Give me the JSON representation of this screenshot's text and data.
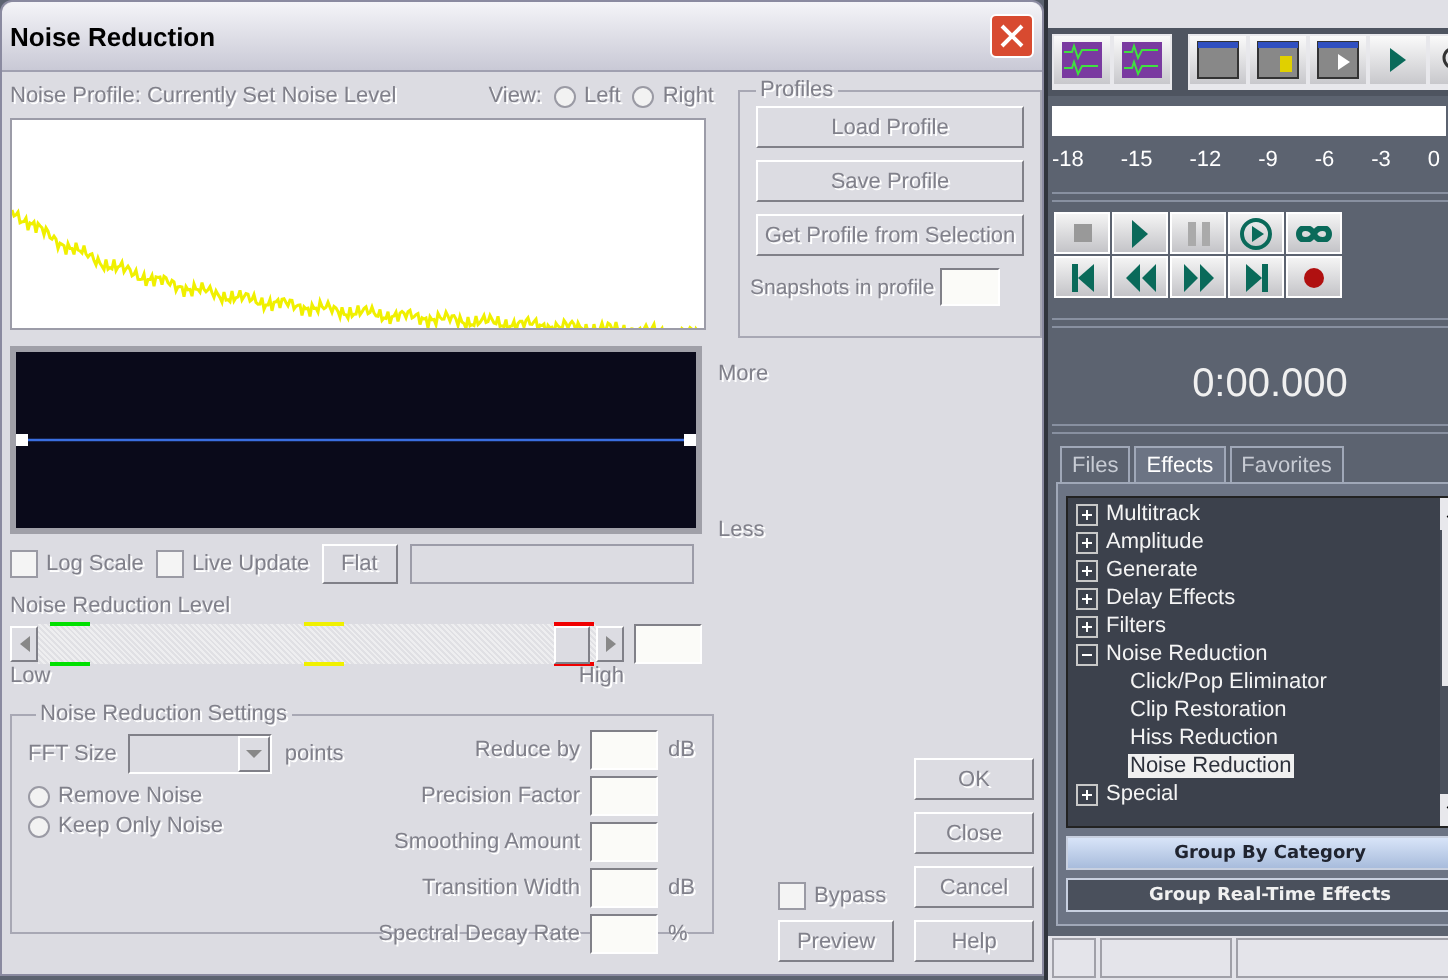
{
  "dialog": {
    "title": "Noise Reduction",
    "disabled": true,
    "profile_label": "Noise Profile: Currently Set Noise Level",
    "view": {
      "label": "View:",
      "options": [
        {
          "label": "Left",
          "selected": false
        },
        {
          "label": "Right",
          "selected": false
        }
      ]
    },
    "graph_labels": {
      "top": "More",
      "bottom": "Less"
    },
    "checkboxes": [
      {
        "label": "Log Scale",
        "checked": false
      },
      {
        "label": "Live Update",
        "checked": false
      }
    ],
    "flat_button": "Flat",
    "reduction_level": {
      "label": "Noise Reduction Level",
      "level": 0.99,
      "low": "Low",
      "high": "High"
    },
    "settings": {
      "title": "Noise Reduction Settings",
      "fft_label": "FFT Size",
      "fft_unit": "points",
      "modes": [
        {
          "label": "Remove Noise",
          "selected": false
        },
        {
          "label": "Keep Only Noise",
          "selected": false
        }
      ],
      "fields": [
        {
          "label": "Reduce by",
          "unit": "dB"
        },
        {
          "label": "Precision Factor"
        },
        {
          "label": "Smoothing Amount"
        },
        {
          "label": "Transition Width",
          "unit": "dB"
        },
        {
          "label": "Spectral Decay Rate",
          "unit": "%"
        }
      ]
    },
    "profiles": {
      "title": "Profiles",
      "buttons": [
        "Load Profile",
        "Save Profile",
        "Get Profile from Selection"
      ],
      "snapshots_label": "Snapshots in profile"
    },
    "bypass": {
      "label": "Bypass",
      "checked": false
    },
    "preview_button": "Preview",
    "buttons": [
      "OK",
      "Close",
      "Cancel",
      "Help"
    ]
  },
  "app": {
    "meter_ticks": [
      "-18",
      "-15",
      "-12",
      "-9",
      "-6",
      "-3",
      "0"
    ],
    "time": "0:00.000",
    "tabs": [
      {
        "label": "Files",
        "selected": false
      },
      {
        "label": "Effects",
        "selected": true
      },
      {
        "label": "Favorites",
        "selected": false
      }
    ],
    "tree": [
      {
        "label": "Multitrack",
        "expanded": false,
        "selected": false
      },
      {
        "label": "Amplitude",
        "expanded": false,
        "selected": false
      },
      {
        "label": "Generate",
        "expanded": false,
        "selected": false
      },
      {
        "label": "Delay Effects",
        "expanded": false,
        "selected": false
      },
      {
        "label": "Filters",
        "expanded": false,
        "selected": false
      },
      {
        "label": "Noise Reduction",
        "expanded": true,
        "selected": false,
        "children": [
          {
            "label": "Click/Pop Eliminator",
            "selected": false
          },
          {
            "label": "Clip Restoration",
            "selected": false
          },
          {
            "label": "Hiss Reduction",
            "selected": false
          },
          {
            "label": "Noise Reduction",
            "selected": true
          }
        ]
      },
      {
        "label": "Special",
        "expanded": false,
        "selected": false
      }
    ],
    "group_buttons": [
      {
        "label": "Group By Category",
        "selected": true
      },
      {
        "label": "Group Real-Time Effects",
        "selected": false
      }
    ]
  }
}
